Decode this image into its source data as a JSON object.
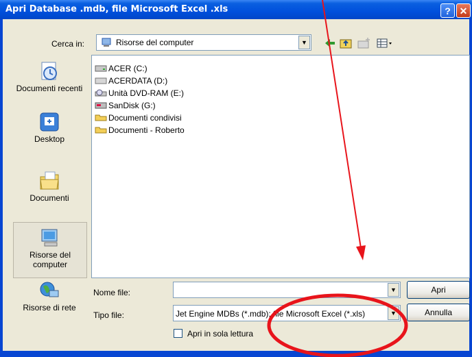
{
  "window": {
    "title": "Apri Database .mdb, file Microsoft Excel .xls",
    "help_glyph": "?",
    "close_glyph": "✕"
  },
  "toolbar": {
    "lookin_label": "Cerca in:",
    "lookin_value": "Risorse del computer",
    "icons": [
      "back-icon",
      "up-folder-icon",
      "new-folder-icon",
      "views-menu-icon"
    ]
  },
  "places": [
    {
      "label": "Documenti recenti",
      "icon": "recent-documents-icon"
    },
    {
      "label": "Desktop",
      "icon": "desktop-icon"
    },
    {
      "label": "Documenti",
      "icon": "my-documents-icon"
    },
    {
      "label": "Risorse del computer",
      "icon": "my-computer-icon"
    },
    {
      "label": "Risorse di rete",
      "icon": "network-icon"
    }
  ],
  "files": [
    {
      "label": "ACER (C:)",
      "icon": "drive-icon"
    },
    {
      "label": "ACERDATA (D:)",
      "icon": "drive-icon"
    },
    {
      "label": "Unità DVD-RAM (E:)",
      "icon": "dvd-drive-icon"
    },
    {
      "label": "SanDisk (G:)",
      "icon": "removable-drive-icon"
    },
    {
      "label": "Documenti condivisi",
      "icon": "folder-icon"
    },
    {
      "label": "Documenti - Roberto",
      "icon": "folder-icon"
    }
  ],
  "form": {
    "filename_label": "Nome file:",
    "filename_value": "",
    "filetype_label": "Tipo file:",
    "filetype_value": "Jet Engine MDBs (*.mdb); file Microsoft Excel (*.xls)",
    "open_label": "Apri",
    "cancel_label": "Annulla",
    "readonly_label": "Apri in sola lettura",
    "readonly_checked": false
  },
  "colors": {
    "titlebar": "#0050dc",
    "annotation": "#e8141b"
  }
}
